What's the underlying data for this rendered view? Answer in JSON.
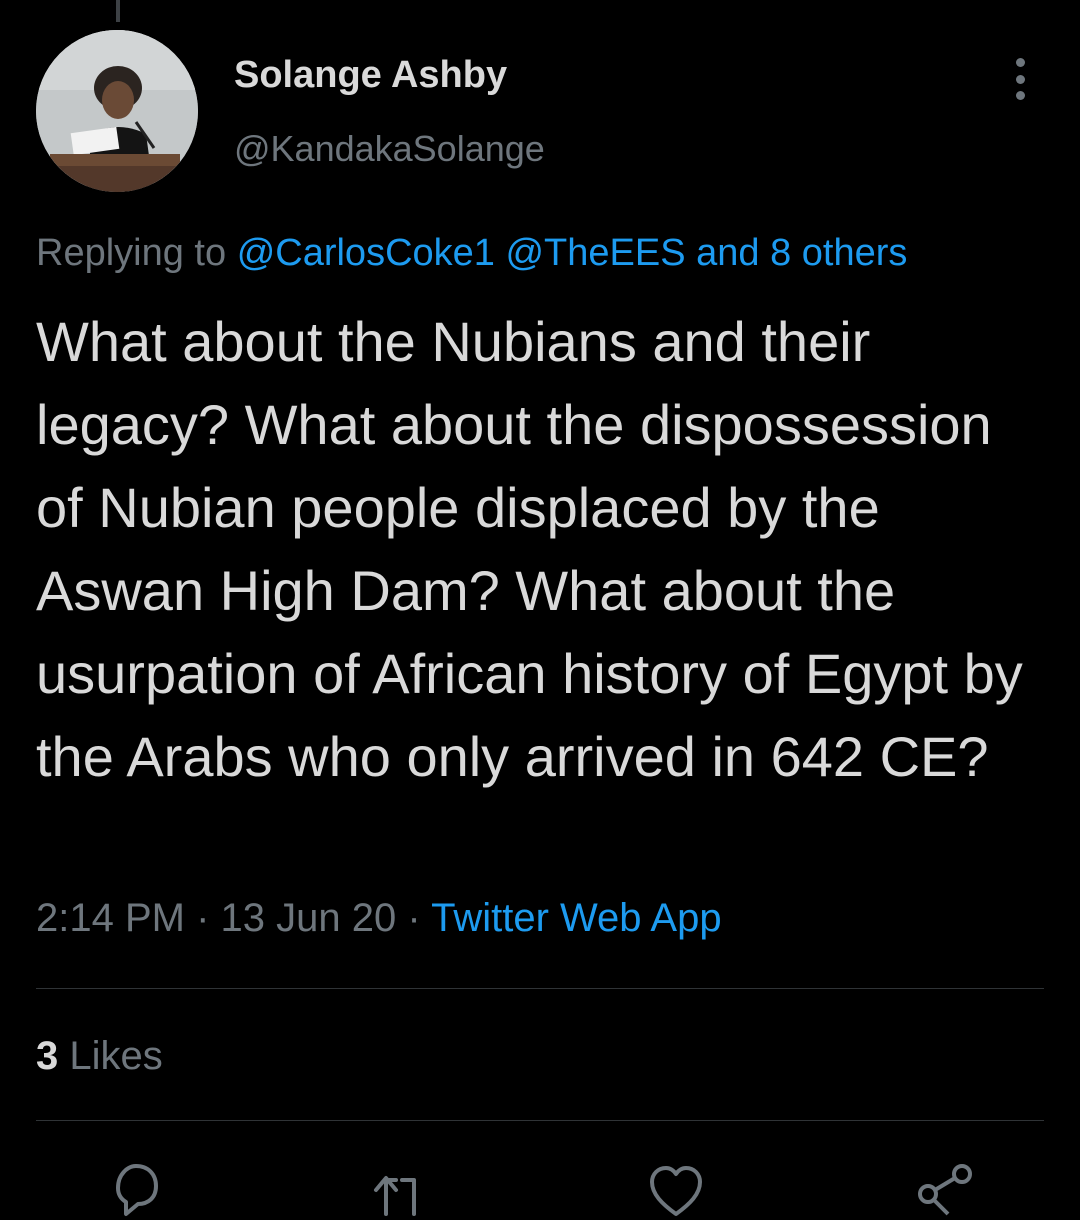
{
  "tweet": {
    "author_name": "Solange Ashby",
    "author_handle": "@KandakaSolange",
    "replying_prefix": "Replying to",
    "reply_mention_1": "@CarlosCoke1",
    "reply_mention_2": "@TheEES and 8 others",
    "text": "What about the Nubians and their legacy? What about the dispossession of Nubian people displaced by the Aswan High Dam? What about the usurpation of African history of Egypt by the Arabs who only arrived in 642 CE?",
    "time": "2:14 PM",
    "date": "13 Jun 20",
    "separator": "·",
    "source": "Twitter Web App"
  },
  "stats": {
    "likes_count": "3",
    "likes_label": "Likes"
  },
  "actions": [
    "reply-icon",
    "retweet-icon",
    "like-icon",
    "share-icon"
  ],
  "colors": {
    "background": "#000000",
    "text": "#d9d9d9",
    "secondary": "#6e767d",
    "link": "#1d9bf0",
    "divider": "#2f3336"
  }
}
